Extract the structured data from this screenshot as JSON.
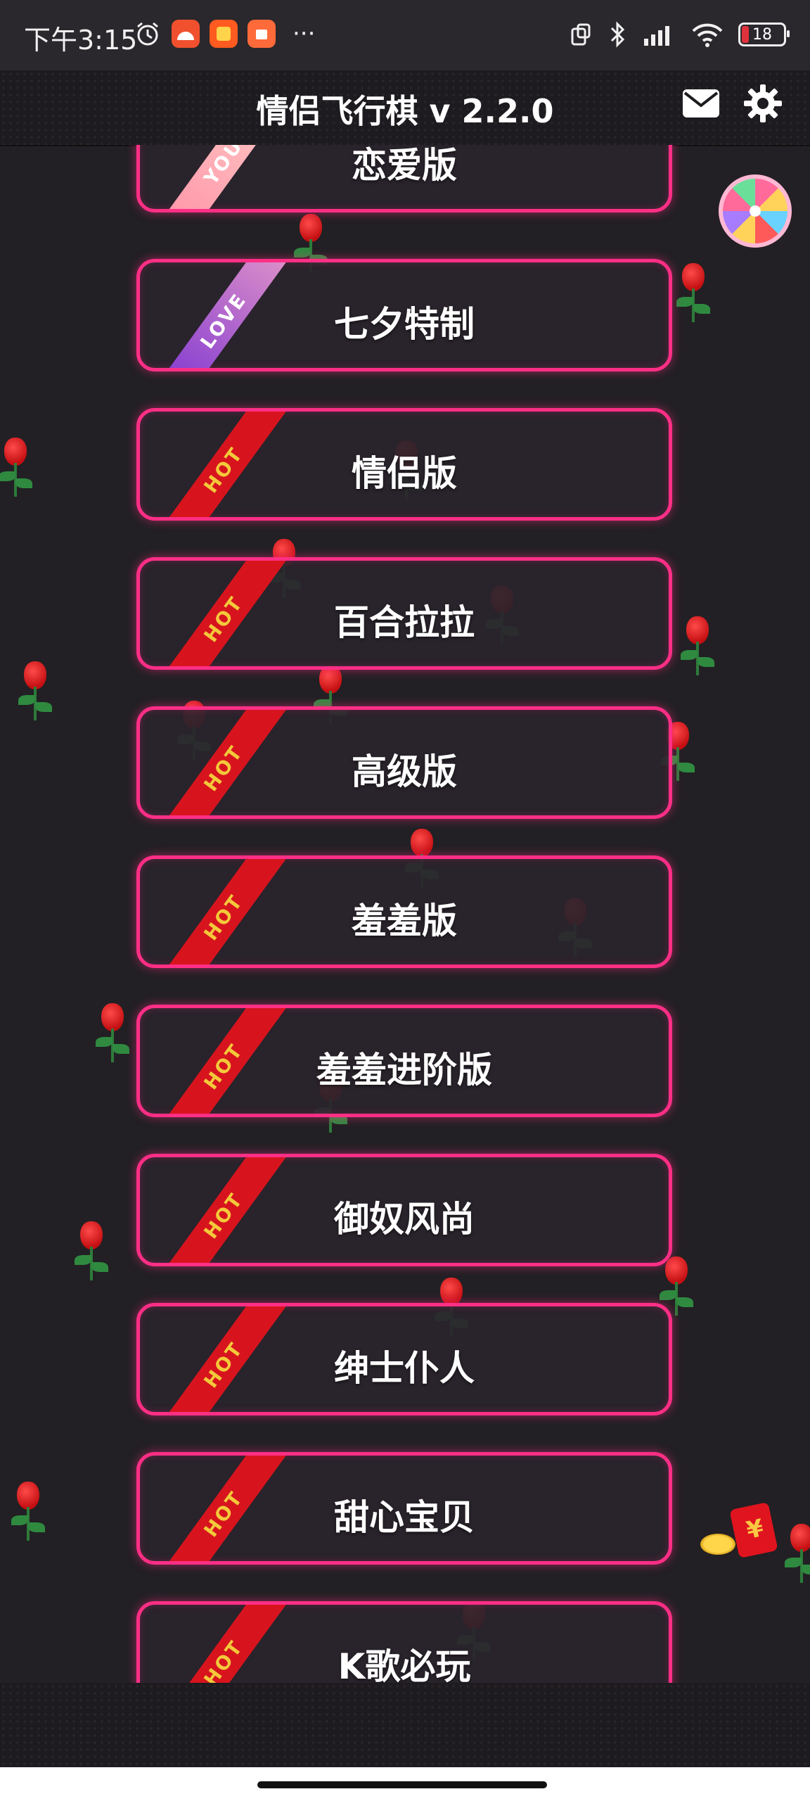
{
  "status_bar": {
    "time": "下午3:15",
    "battery_level": "18",
    "more_indicator": "···"
  },
  "header": {
    "title": "情侣飞行棋 v 2.2.0"
  },
  "modes": [
    {
      "label": "恋爱版",
      "ribbon": "YOU"
    },
    {
      "label": "七夕特制",
      "ribbon": "LOVE"
    },
    {
      "label": "情侣版",
      "ribbon": "HOT"
    },
    {
      "label": "百合拉拉",
      "ribbon": "HOT"
    },
    {
      "label": "高级版",
      "ribbon": "HOT"
    },
    {
      "label": "羞羞版",
      "ribbon": "HOT"
    },
    {
      "label": "羞羞进阶版",
      "ribbon": "HOT"
    },
    {
      "label": "御奴风尚",
      "ribbon": "HOT"
    },
    {
      "label": "绅士仆人",
      "ribbon": "HOT"
    },
    {
      "label": "甜心宝贝",
      "ribbon": "HOT"
    },
    {
      "label": "K歌必玩",
      "ribbon": "HOT"
    }
  ],
  "floating": {
    "redpacket_symbol": "¥"
  },
  "colors": {
    "accent": "#ff2f86",
    "hot_ribbon": "#d7141e",
    "hot_text": "#f3c93a",
    "background": "#222024"
  }
}
